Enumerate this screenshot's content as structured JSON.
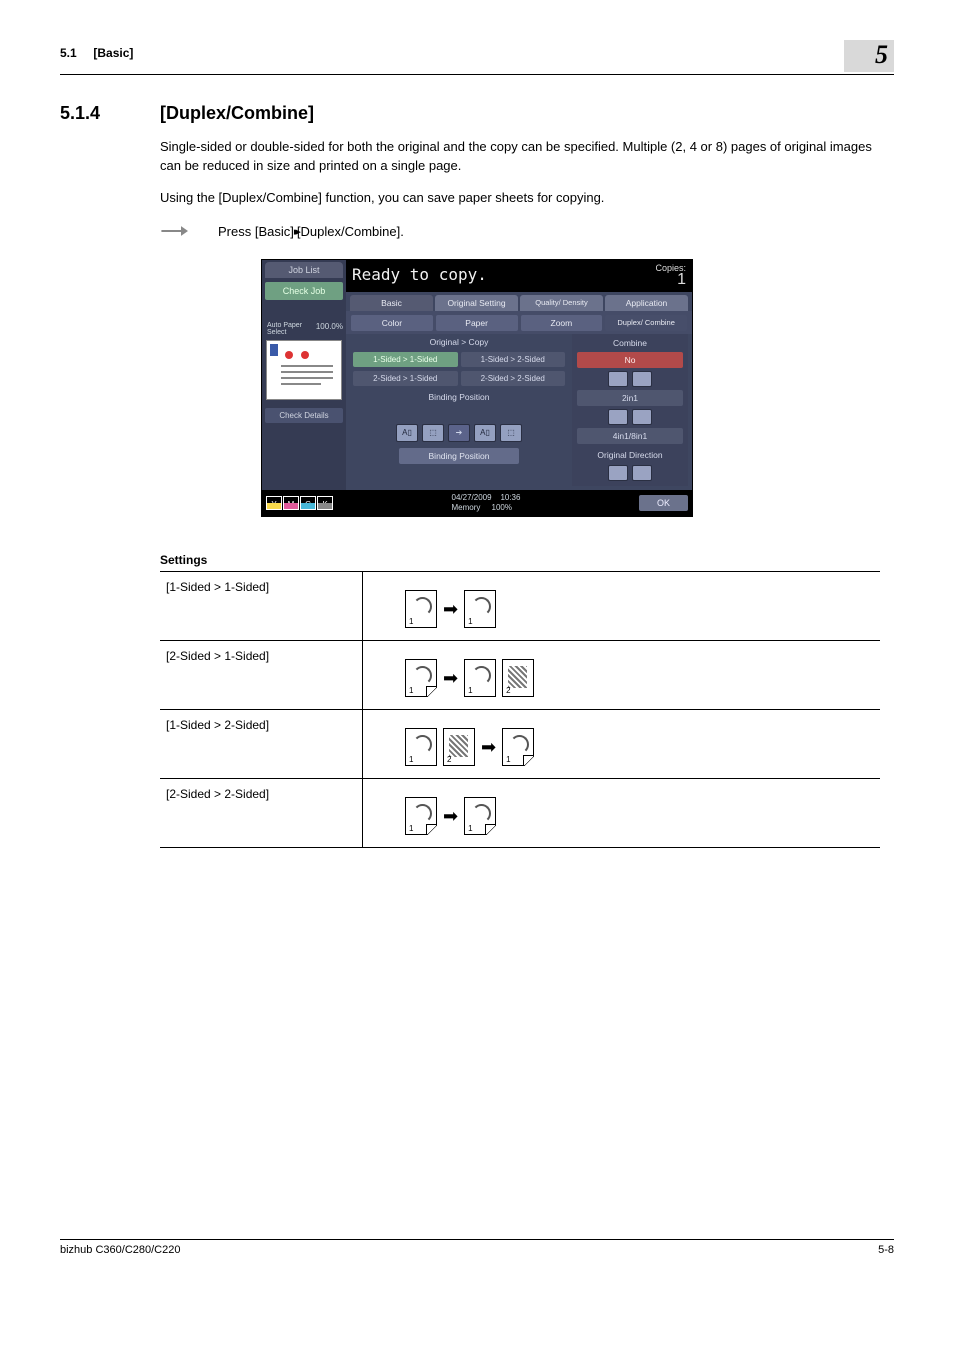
{
  "header": {
    "section_ref": "5.1",
    "section_ref_label": "[Basic]",
    "chapter_num": "5"
  },
  "section": {
    "number": "5.1.4",
    "title": "[Duplex/Combine]"
  },
  "paragraphs": {
    "p1": "Single-sided or double-sided for both the original and the copy can be specified. Multiple (2, 4 or 8) pages of original images can be reduced in size and printed on a single page.",
    "p2": "Using the [Duplex/Combine] function, you can save paper sheets for copying.",
    "press_line_pre": "Press [Basic] ",
    "press_line_post": " [Duplex/Combine]."
  },
  "screenshot": {
    "job_list": "Job List",
    "check_job": "Check Job",
    "auto_paper_label": "Auto Paper Select",
    "auto_paper_val": "100.0%",
    "check_details": "Check Details",
    "ready": "Ready to copy.",
    "copies_label": "Copies:",
    "copies_num": "1",
    "tabs": {
      "basic": "Basic",
      "orig_setting": "Original Setting",
      "density_q": "Quality/ Density",
      "application": "Application"
    },
    "subtabs": {
      "color": "Color",
      "paper": "Paper",
      "zoom": "Zoom",
      "duplex": "Duplex/ Combine"
    },
    "orig_copy": "Original > Copy",
    "opts": {
      "o1": "1-Sided > 1-Sided",
      "o2": "1-Sided > 2-Sided",
      "o3": "2-Sided > 1-Sided",
      "o4": "2-Sided > 2-Sided"
    },
    "binding_header": "Binding Position",
    "binding_btn": "Binding Position",
    "right": {
      "combine": "Combine",
      "no": "No",
      "two": "2in1",
      "four": "4in1/8in1",
      "orig_dir": "Original Direction"
    },
    "toner": {
      "y": "Y",
      "m": "M",
      "c": "C",
      "k": "K"
    },
    "date": "04/27/2009",
    "time": "10:36",
    "memory": "Memory",
    "mem_val": "100%",
    "ok": "OK"
  },
  "settings": {
    "heading": "Settings",
    "rows": [
      "[1-Sided > 1-Sided]",
      "[2-Sided > 1-Sided]",
      "[1-Sided > 2-Sided]",
      "[2-Sided > 2-Sided]"
    ]
  },
  "footer": {
    "left": "bizhub C360/C280/C220",
    "right": "5-8"
  }
}
